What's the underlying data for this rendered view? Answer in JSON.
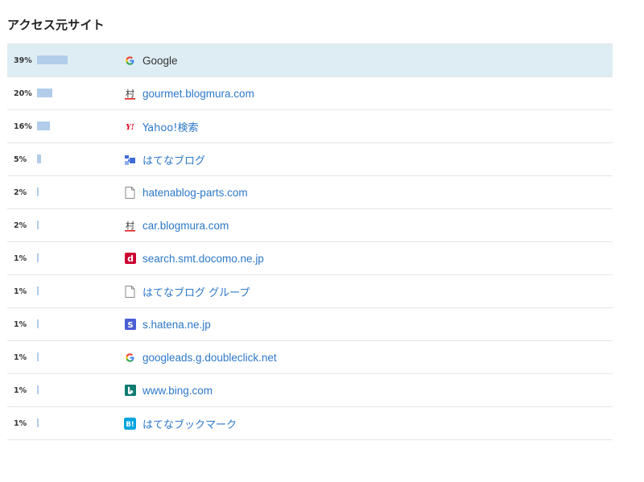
{
  "title": "アクセス元サイト",
  "rows": [
    {
      "pct": "39%",
      "value": 39,
      "label": "Google",
      "icon": "google-icon"
    },
    {
      "pct": "20%",
      "value": 20,
      "label": "gourmet.blogmura.com",
      "icon": "blogmura-icon"
    },
    {
      "pct": "16%",
      "value": 16,
      "label": "Yahoo!検索",
      "icon": "yahoo-icon"
    },
    {
      "pct": "5%",
      "value": 5,
      "label": "はてなブログ",
      "icon": "hatena-blog-icon"
    },
    {
      "pct": "2%",
      "value": 2,
      "label": "hatenablog-parts.com",
      "icon": "document-icon"
    },
    {
      "pct": "2%",
      "value": 2,
      "label": "car.blogmura.com",
      "icon": "blogmura-icon"
    },
    {
      "pct": "1%",
      "value": 1,
      "label": "search.smt.docomo.ne.jp",
      "icon": "docomo-icon"
    },
    {
      "pct": "1%",
      "value": 1,
      "label": "はてなブログ グループ",
      "icon": "document-icon"
    },
    {
      "pct": "1%",
      "value": 1,
      "label": "s.hatena.ne.jp",
      "icon": "hatena-star-icon"
    },
    {
      "pct": "1%",
      "value": 1,
      "label": "googleads.g.doubleclick.net",
      "icon": "google-icon"
    },
    {
      "pct": "1%",
      "value": 1,
      "label": "www.bing.com",
      "icon": "bing-icon"
    },
    {
      "pct": "1%",
      "value": 1,
      "label": "はてなブックマーク",
      "icon": "hatena-bookmark-icon"
    }
  ],
  "colors": {
    "bar": "#b1cde9",
    "highlight": "#deedf4",
    "link": "#2d78c8"
  }
}
